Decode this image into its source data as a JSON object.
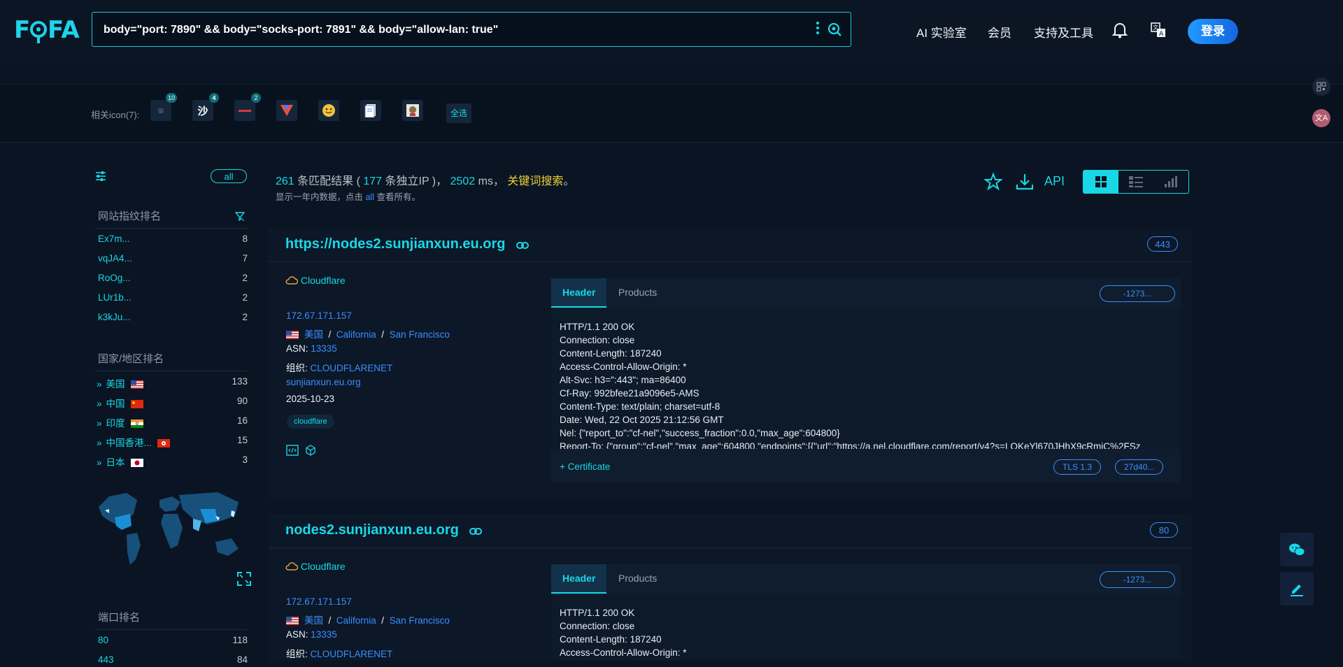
{
  "header": {
    "logo_text": "FOFA",
    "search_query": "body=\"port: 7890\" && body=\"socks-port: 7891\" && body=\"allow-lan: true\"",
    "nav": [
      "AI 实验室",
      "会员",
      "支持及工具"
    ],
    "login_label": "登录"
  },
  "related_icons": {
    "label": "相关icon(7):",
    "items": [
      {
        "glyph": "",
        "badge": "10"
      },
      {
        "glyph": "沙",
        "badge": "4"
      },
      {
        "glyph": "",
        "badge": "2"
      },
      {
        "glyph": "V",
        "badge": ""
      },
      {
        "glyph": "☺",
        "badge": ""
      },
      {
        "glyph": "",
        "badge": ""
      },
      {
        "glyph": "",
        "badge": ""
      }
    ],
    "select_all": "全选"
  },
  "sidebar": {
    "all_label": "all",
    "fingerprint_title": "网站指纹排名",
    "fingerprints": [
      {
        "name": "Ex7m...",
        "count": "8"
      },
      {
        "name": "vqJA4...",
        "count": "7"
      },
      {
        "name": "RoOg...",
        "count": "2"
      },
      {
        "name": "LUr1b...",
        "count": "2"
      },
      {
        "name": "k3kJu...",
        "count": "2"
      }
    ],
    "country_title": "国家/地区排名",
    "countries": [
      {
        "name": "美国",
        "count": "133",
        "flag": "us"
      },
      {
        "name": "中国",
        "count": "90",
        "flag": "cn"
      },
      {
        "name": "印度",
        "count": "16",
        "flag": "in"
      },
      {
        "name": "中国香港...",
        "count": "15",
        "flag": "hk"
      },
      {
        "name": "日本",
        "count": "3",
        "flag": "jp"
      }
    ],
    "port_title": "端口排名",
    "ports": [
      {
        "name": "80",
        "count": "118"
      },
      {
        "name": "443",
        "count": "84"
      }
    ]
  },
  "summary": {
    "total": "261",
    "text1": " 条匹配结果 ( ",
    "ips": "177",
    "text2": " 条独立IP )， ",
    "ms": "2502",
    "text3": " ms， ",
    "keyword": "关键词搜索",
    "end": "。",
    "note_pre": "显示一年内数据，点击 ",
    "note_all": "all",
    "note_post": " 查看所有。",
    "api_label": "API"
  },
  "results": [
    {
      "title": "https://nodes2.sunjianxun.eu.org",
      "port": "443",
      "org_tag": "Cloudflare",
      "ip": "172.67.171.157",
      "country": "美国",
      "region": "California",
      "city": "San Francisco",
      "asn_label": "ASN: ",
      "asn": "13335",
      "org_label": "组织: ",
      "org": "CLOUDFLARENET",
      "domain": "sunjianxun.eu.org",
      "date": "2025-10-23",
      "tag": "cloudflare",
      "tab_header": "Header",
      "tab_products": "Products",
      "hash": "-1273...",
      "header_text": "HTTP/1.1 200 OK\nConnection: close\nContent-Length: 187240\nAccess-Control-Allow-Origin: *\nAlt-Svc: h3=\":443\"; ma=86400\nCf-Ray: 992bfee21a9096e5-AMS\nContent-Type: text/plain; charset=utf-8\nDate: Wed, 22 Oct 2025 21:12:56 GMT\nNel: {\"report_to\":\"cf-nel\",\"success_fraction\":0.0,\"max_age\":604800}\nReport-To: {\"group\":\"cf-nel\",\"max_age\":604800,\"endpoints\":[{\"url\":\"https://a.nel.cloudflare.com/report/v4?s=LQKeYl670JHhX9cRmjC%2FSz",
      "cert_label": "Certificate",
      "tls": "TLS 1.3",
      "cert_hash": "27d40..."
    },
    {
      "title": "nodes2.sunjianxun.eu.org",
      "port": "80",
      "org_tag": "Cloudflare",
      "ip": "172.67.171.157",
      "country": "美国",
      "region": "California",
      "city": "San Francisco",
      "asn_label": "ASN: ",
      "asn": "13335",
      "org_label": "组织: ",
      "org": "CLOUDFLARENET",
      "tab_header": "Header",
      "tab_products": "Products",
      "hash": "-1273...",
      "header_text": "HTTP/1.1 200 OK\nConnection: close\nContent-Length: 187240\nAccess-Control-Allow-Origin: *"
    }
  ],
  "colors": {
    "accent": "#18d8e6",
    "link": "#3a8fff",
    "keyword": "#f0d13a",
    "background": "#0a1422"
  }
}
